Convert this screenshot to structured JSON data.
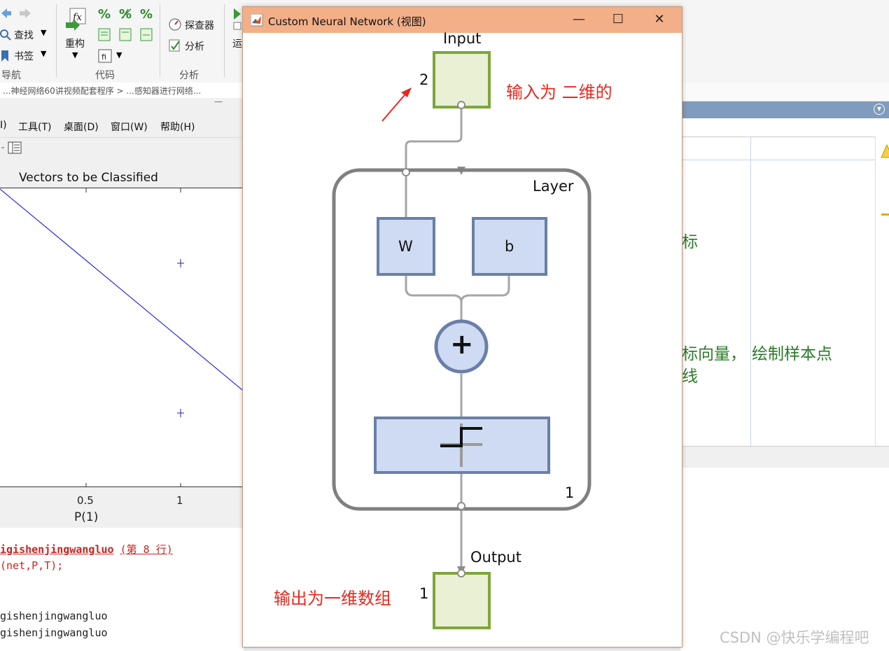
{
  "ribbon": {
    "nav_find": "查找",
    "nav_bookmark": "书签",
    "nav_group": "导航",
    "refactor": "重构",
    "code_group": "代码",
    "explorer": "探查器",
    "analyze": "分析",
    "analysis_group": "分析",
    "run_partial": "运"
  },
  "breadcrumb": "...神经网络60讲视频配套程序 > ...感知器进行网络...",
  "figure": {
    "menu": [
      "I)",
      "工具(T)",
      "桌面(D)",
      "窗口(W)",
      "帮助(H)"
    ],
    "title": "Vectors to be Classified",
    "xlabel": "P(1)",
    "xticks": [
      "0.5",
      "1"
    ],
    "minimize_glyph": "—"
  },
  "chart_data": {
    "type": "scatter",
    "title": "Vectors to be Classified",
    "xlabel": "P(1)",
    "ylabel": "",
    "xticks": [
      0.5,
      1
    ],
    "points": [
      {
        "x": 1,
        "y": 1,
        "marker": "+"
      },
      {
        "x": 1,
        "y": 0,
        "marker": "+"
      }
    ],
    "decision_line_color": "#0000ff"
  },
  "command_window": {
    "line1_link": "igishenjingwangluo",
    "line1_suffix": "(第 8 行)",
    "line2": "(net,P,T);",
    "line3": "gishenjingwangluo",
    "line4": "gishenjingwangluo",
    "error_color": "#cc2222"
  },
  "right_pane": {
    "text1": "标",
    "text2": "标向量，",
    "text3": "绘制样本点",
    "text4": "线"
  },
  "dialog": {
    "title": "Custom Neural Network (视图)",
    "minimize": "—",
    "maximize": "☐",
    "close": "✕",
    "input_label": "Input",
    "input_size": "2",
    "input_note": "输入为 二维的",
    "layer_label": "Layer",
    "weight_label": "W",
    "bias_label": "b",
    "sum_symbol": "+",
    "layer_count": "1",
    "output_label": "Output",
    "output_size": "1",
    "output_note": "输出为一维数组",
    "annotation_color": "#e8281e",
    "io_fill": "#e9f0d4",
    "io_border": "#7ea63a",
    "block_fill": "#cedbf2",
    "block_border": "#6a7fa8"
  },
  "watermark": "CSDN @快乐学编程吧"
}
